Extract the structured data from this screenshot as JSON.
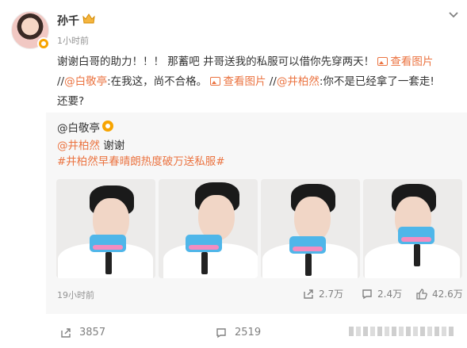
{
  "post": {
    "author": "孙千",
    "time": "1小时前",
    "content": {
      "line1_text": "谢谢白哥的助力！！！ 那蓄吧 井哥送我的私服可以借你先穿两天！",
      "view_pic_1": "查看图片",
      "line2_prefix": "//",
      "mention_1": "@白敬亭",
      "line2_mid": ":在我这，尚不合格。",
      "view_pic_2": "查看图片",
      "line2_sep": " //",
      "mention_2": "@井柏然",
      "line2_end": ":你不是已经拿了一套走!",
      "line3": "还要?"
    }
  },
  "repost": {
    "author": "@白敬亭",
    "reply_mention": "@井柏然",
    "reply_text": " 谢谢",
    "hashtag": "#井柏然早春晴朗热度破万送私服#",
    "time": "19小时前",
    "stats": {
      "reposts": "2.7万",
      "comments": "2.4万",
      "likes": "42.6万"
    },
    "photos": [
      "photo-1",
      "photo-2",
      "photo-3",
      "photo-4"
    ]
  },
  "footer": {
    "reposts": "3857",
    "comments": "2519"
  },
  "colors": {
    "link": "#eb7340",
    "muted": "#939393",
    "badge": "#f7a400",
    "repost_bg": "#f7f7f7"
  }
}
